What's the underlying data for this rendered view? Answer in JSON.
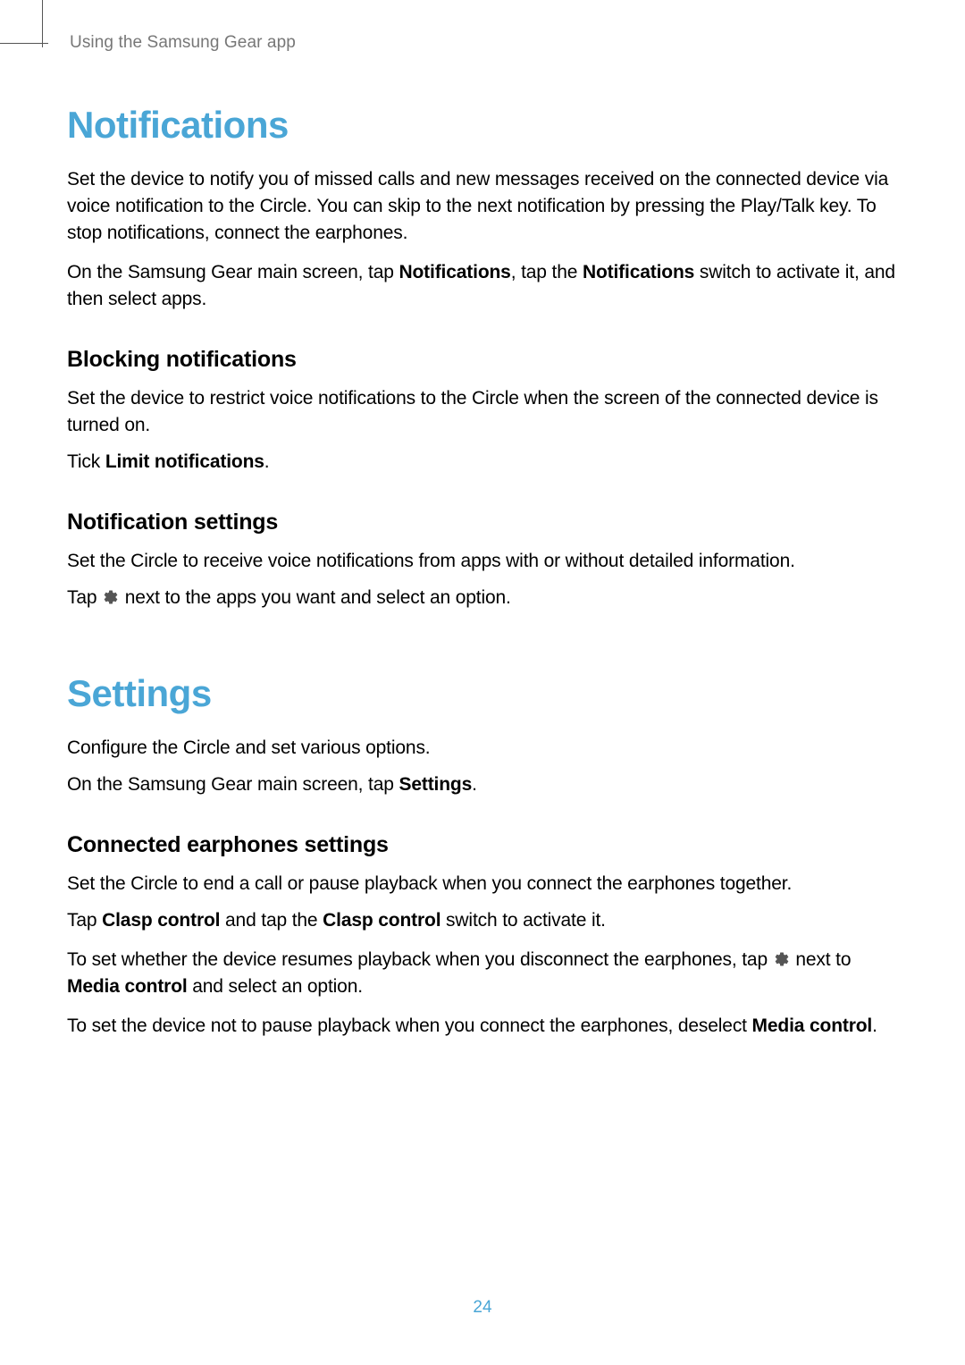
{
  "runningHeader": "Using the Samsung Gear app",
  "pageNumber": "24",
  "sections": {
    "notifications": {
      "heading": "Notifications",
      "p1": "Set the device to notify you of missed calls and new messages received on the connected device via voice notification to the Circle. You can skip to the next notification by pressing the Play/Talk key. To stop notifications, connect the earphones.",
      "p2a": "On the Samsung Gear main screen, tap ",
      "p2b_bold": "Notifications",
      "p2c": ", tap the ",
      "p2d_bold": "Notifications",
      "p2e": " switch to activate it, and then select apps.",
      "blocking": {
        "heading": "Blocking notifications",
        "p1": "Set the device to restrict voice notifications to the Circle when the screen of the connected device is turned on.",
        "p2a": "Tick ",
        "p2b_bold": "Limit notifications",
        "p2c": "."
      },
      "settings": {
        "heading": "Notification settings",
        "p1": "Set the Circle to receive voice notifications from apps with or without detailed information.",
        "p2a": "Tap ",
        "p2b": " next to the apps you want and select an option."
      }
    },
    "settings": {
      "heading": "Settings",
      "p1": "Configure the Circle and set various options.",
      "p2a": "On the Samsung Gear main screen, tap ",
      "p2b_bold": "Settings",
      "p2c": ".",
      "earphones": {
        "heading": "Connected earphones settings",
        "p1": "Set the Circle to end a call or pause playback when you connect the earphones together.",
        "p2a": "Tap ",
        "p2b_bold": "Clasp control",
        "p2c": " and tap the ",
        "p2d_bold": "Clasp control",
        "p2e": " switch to activate it.",
        "p3a": "To set whether the device resumes playback when you disconnect the earphones, tap ",
        "p3b": " next to ",
        "p3c_bold": "Media control",
        "p3d": " and select an option.",
        "p4a": "To set the device not to pause playback when you connect the earphones, deselect ",
        "p4b_bold": "Media control",
        "p4c": "."
      }
    }
  }
}
